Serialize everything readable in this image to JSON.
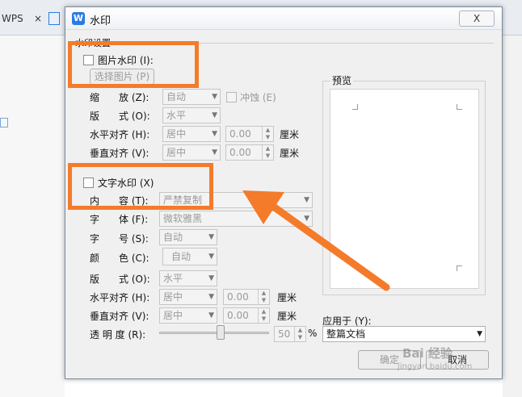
{
  "background": {
    "tab_wps": "WPS",
    "tab_close": "×"
  },
  "dialog": {
    "title": "水印",
    "close_label": "X",
    "group_label": "水印设置",
    "picture": {
      "checkbox_label": "图片水印 (I):",
      "select_image_button": "选择图片 (P)",
      "scale_label": "缩　　放 (Z):",
      "scale_value": "自动",
      "washout_label": "冲蚀 (E)",
      "layout_label": "版　　式 (O):",
      "layout_value": "水平",
      "halign_label": "水平对齐 (H):",
      "halign_value": "居中",
      "halign_offset": "0.00",
      "valign_label": "垂直对齐 (V):",
      "valign_value": "居中",
      "valign_offset": "0.00",
      "unit": "厘米"
    },
    "text": {
      "checkbox_label": "文字水印 (X)",
      "content_label": "内　　容 (T):",
      "content_value": "严禁复制",
      "font_label": "字　　体 (F):",
      "font_value": "微软雅黑",
      "size_label": "字　　号 (S):",
      "size_value": "自动",
      "color_label": "颜　　色 (C):",
      "color_value": "自动",
      "layout_label": "版　　式 (O):",
      "layout_value": "水平",
      "halign_label": "水平对齐 (H):",
      "halign_value": "居中",
      "halign_offset": "0.00",
      "valign_label": "垂直对齐 (V):",
      "valign_value": "居中",
      "valign_offset": "0.00",
      "unit": "厘米",
      "transparency_label": "透 明 度 (R):",
      "transparency_value": "50",
      "transparency_unit": "%"
    },
    "preview_label": "预览",
    "apply_to_label": "应用于 (Y):",
    "apply_to_value": "整篇文档",
    "ok_label": "确定",
    "cancel_label": "取消"
  },
  "watermark_text": "Bai 经验",
  "watermark_url": "jingyan.baidu.com",
  "colors": {
    "annotation": "#f47b2a",
    "title_icon": "#2b7be4"
  }
}
